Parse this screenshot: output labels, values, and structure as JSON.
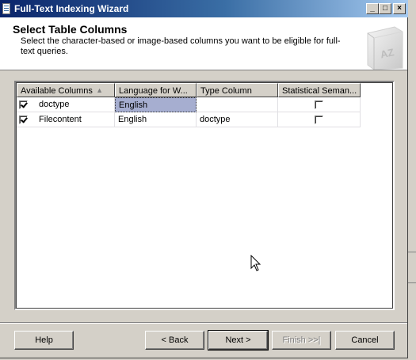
{
  "window": {
    "title": "Full-Text Indexing Wizard",
    "minimize_glyph": "_",
    "maximize_glyph": "□",
    "close_glyph": "×"
  },
  "header": {
    "title": "Select Table Columns",
    "description": "Select the character-based or image-based columns you want to be eligible for full-text queries.",
    "graphic_text": "AZ"
  },
  "grid": {
    "columns": [
      "Available Columns",
      "Language for W...",
      "Type Column",
      "Statistical Seman..."
    ],
    "sort_indicator": "▲",
    "rows": [
      {
        "checked": true,
        "name": "doctype",
        "language": "English",
        "type_column": "",
        "statistical": false
      },
      {
        "checked": true,
        "name": "Filecontent",
        "language": "English",
        "type_column": "doctype",
        "statistical": false
      }
    ]
  },
  "buttons": {
    "help": "Help",
    "back": "< Back",
    "next": "Next >",
    "finish": "Finish >>|",
    "cancel": "Cancel"
  }
}
